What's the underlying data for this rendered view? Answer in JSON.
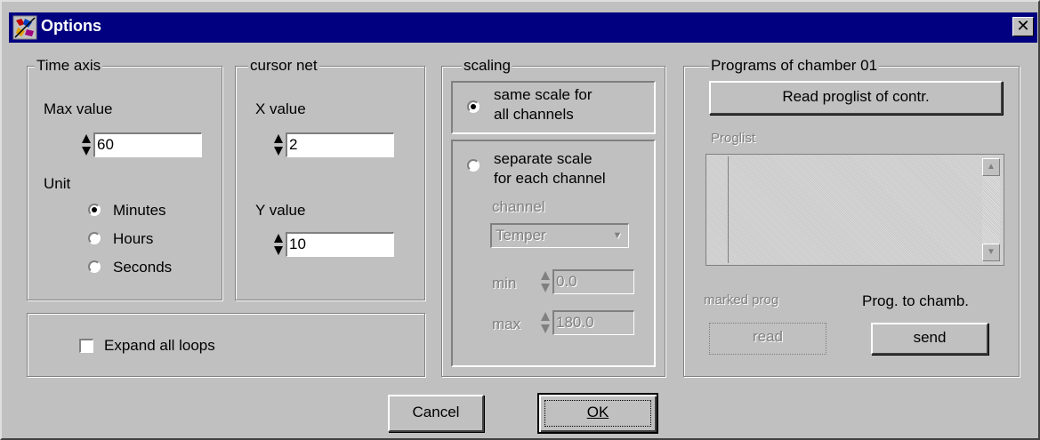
{
  "window": {
    "title": "Options",
    "close_label": "✕"
  },
  "time_axis": {
    "group_title": "Time axis",
    "max_value_label": "Max value",
    "max_value": "60",
    "unit_label": "Unit",
    "units": [
      "Minutes",
      "Hours",
      "Seconds"
    ],
    "selected_unit": "Minutes"
  },
  "cursor_net": {
    "group_title": "cursor net",
    "x_label": "X value",
    "x_value": "2",
    "y_label": "Y value",
    "y_value": "10"
  },
  "loops": {
    "expand_label": "Expand all loops",
    "checked": false
  },
  "scaling": {
    "group_title": "scaling",
    "same_scale_line1": "same scale for",
    "same_scale_line2": "all channels",
    "separate_line1": "separate scale",
    "separate_line2": "for each channel",
    "channel_label": "channel",
    "channel_value": "Temper",
    "min_label": "min",
    "min_value": "0.0",
    "max_label": "max",
    "max_value": "180.0",
    "selected": "same"
  },
  "programs": {
    "group_title": "Programs of chamber 01",
    "read_list_button": "Read proglist of contr.",
    "proglist_label": "Proglist",
    "marked_prog_label": "marked prog",
    "read_button": "read",
    "prog_to_chamb_label": "Prog. to chamb.",
    "send_button": "send"
  },
  "footer": {
    "cancel_button": "Cancel",
    "ok_button": "OK"
  },
  "colors": {
    "titlebar": "#000080",
    "face": "#c0c0c0"
  }
}
